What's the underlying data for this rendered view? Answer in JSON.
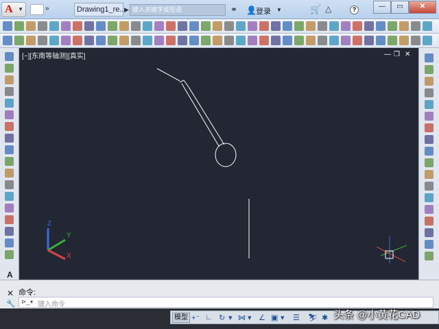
{
  "titlebar": {
    "app_letter": "A",
    "document_title": "Drawing1_re...",
    "search_placeholder": "键入关键字或短语",
    "login_label": "登录",
    "help_label": "?",
    "minimize": "—",
    "restore": "▭",
    "close": "✕"
  },
  "viewport": {
    "label": "[−][东南等轴测][真实]",
    "controls": [
      "—",
      "❐",
      "✕"
    ],
    "ucs_axes": [
      "Z",
      "Y",
      "X"
    ],
    "background_color": "#222733"
  },
  "command": {
    "history_label": "命令:",
    "input_placeholder": "键入命令"
  },
  "status": {
    "model_label": "模型"
  },
  "watermark": "头条 @小黄花CAD",
  "colors": {
    "accent": "#1d4f91",
    "axis_x": "#d84545",
    "axis_y": "#3fae3f",
    "axis_z": "#3c6fd6"
  }
}
